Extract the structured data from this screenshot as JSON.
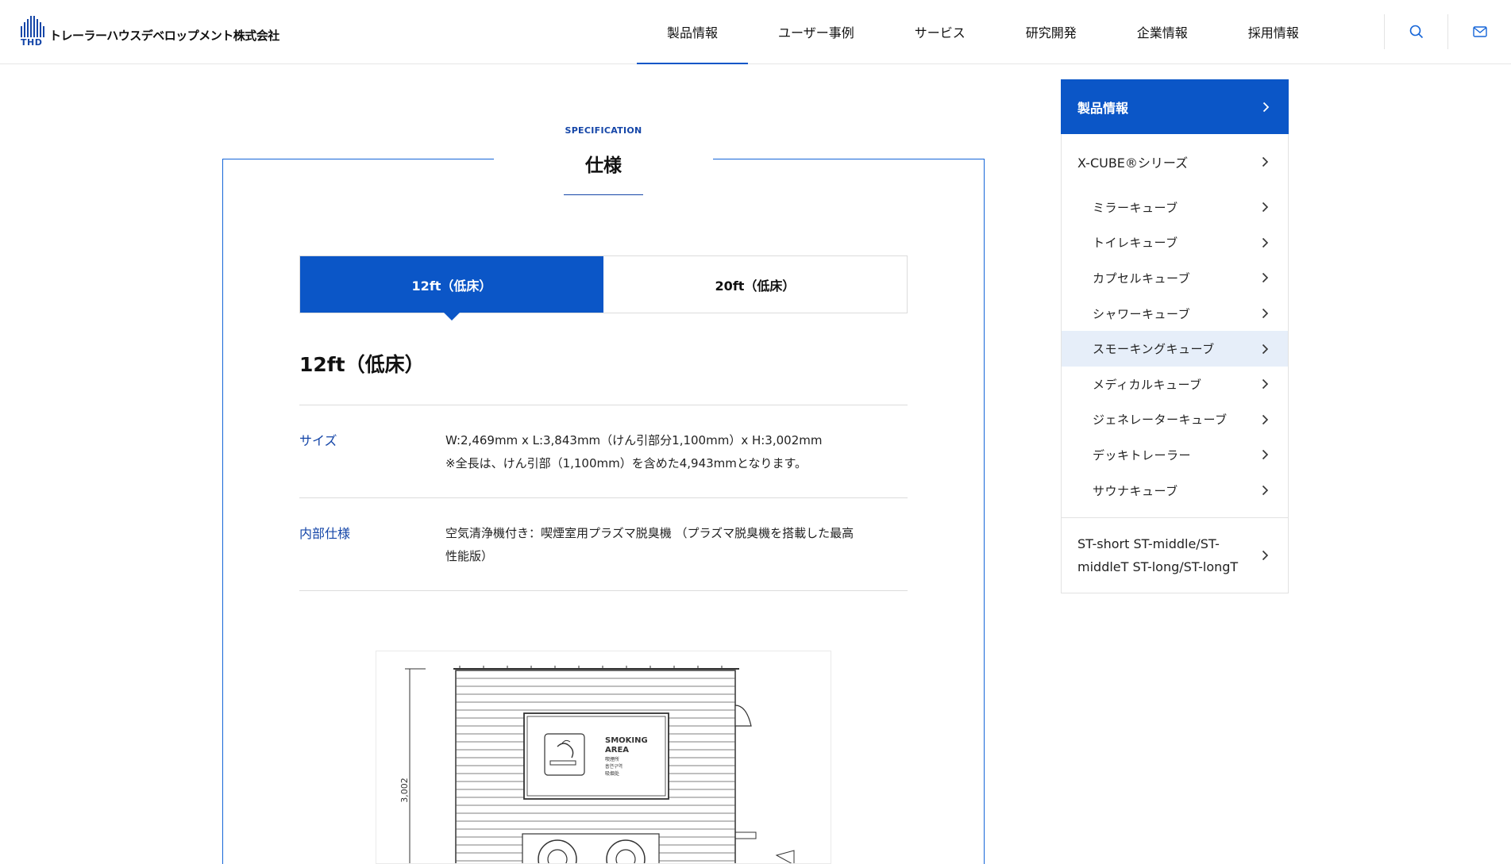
{
  "header": {
    "logo_mark": "THD",
    "company_name": "トレーラーハウスデベロップメント株式会社",
    "nav": [
      {
        "label": "製品情報",
        "active": true
      },
      {
        "label": "ユーザー事例",
        "active": false
      },
      {
        "label": "サービス",
        "active": false
      },
      {
        "label": "研究開発",
        "active": false
      },
      {
        "label": "企業情報",
        "active": false
      },
      {
        "label": "採用情報",
        "active": false
      }
    ],
    "icons": [
      "search-icon",
      "mail-icon"
    ]
  },
  "spec": {
    "eyebrow": "SPECIFICATION",
    "title": "仕様",
    "tabs": [
      {
        "label": "12ft（低床）",
        "active": true
      },
      {
        "label": "20ft（低床）",
        "active": false
      }
    ],
    "heading": "12ft（低床）",
    "rows": [
      {
        "label": "サイズ",
        "line1": "W:2,469mm x L:3,843mm（けん引部分1,100mm）x H:3,002mm",
        "line2": "※全長は、けん引部（1,100mm）を含めた4,943mmとなります。"
      },
      {
        "label": "内部仕様",
        "line1": "空気清浄機付き：喫煙室用プラズマ脱臭機 （プラズマ脱臭機を搭載した最高",
        "line2": "性能版）"
      }
    ],
    "drawing": {
      "dimension_label": "3,002",
      "sign_line1": "SMOKING",
      "sign_line2": "AREA",
      "sign_sub1": "喫煙所",
      "sign_sub2": "흡연구역",
      "sign_sub3": "吸烟处"
    }
  },
  "sidebar": {
    "head": "製品情報",
    "group1": "X-CUBE®シリーズ",
    "items": [
      {
        "label": "ミラーキューブ",
        "active": false
      },
      {
        "label": "トイレキューブ",
        "active": false
      },
      {
        "label": "カプセルキューブ",
        "active": false
      },
      {
        "label": "シャワーキューブ",
        "active": false
      },
      {
        "label": "スモーキングキューブ",
        "active": true
      },
      {
        "label": "メディカルキューブ",
        "active": false
      },
      {
        "label": "ジェネレーターキューブ",
        "active": false
      },
      {
        "label": "デッキトレーラー",
        "active": false
      },
      {
        "label": "サウナキューブ",
        "active": false
      }
    ],
    "group2_line1": "ST-short ST-middle/ST-",
    "group2_line2": "middleT ST-long/ST-longT"
  },
  "colors": {
    "primary": "#0b56c7",
    "accent_text": "#1546a8",
    "active_bg": "#e6eef9"
  }
}
